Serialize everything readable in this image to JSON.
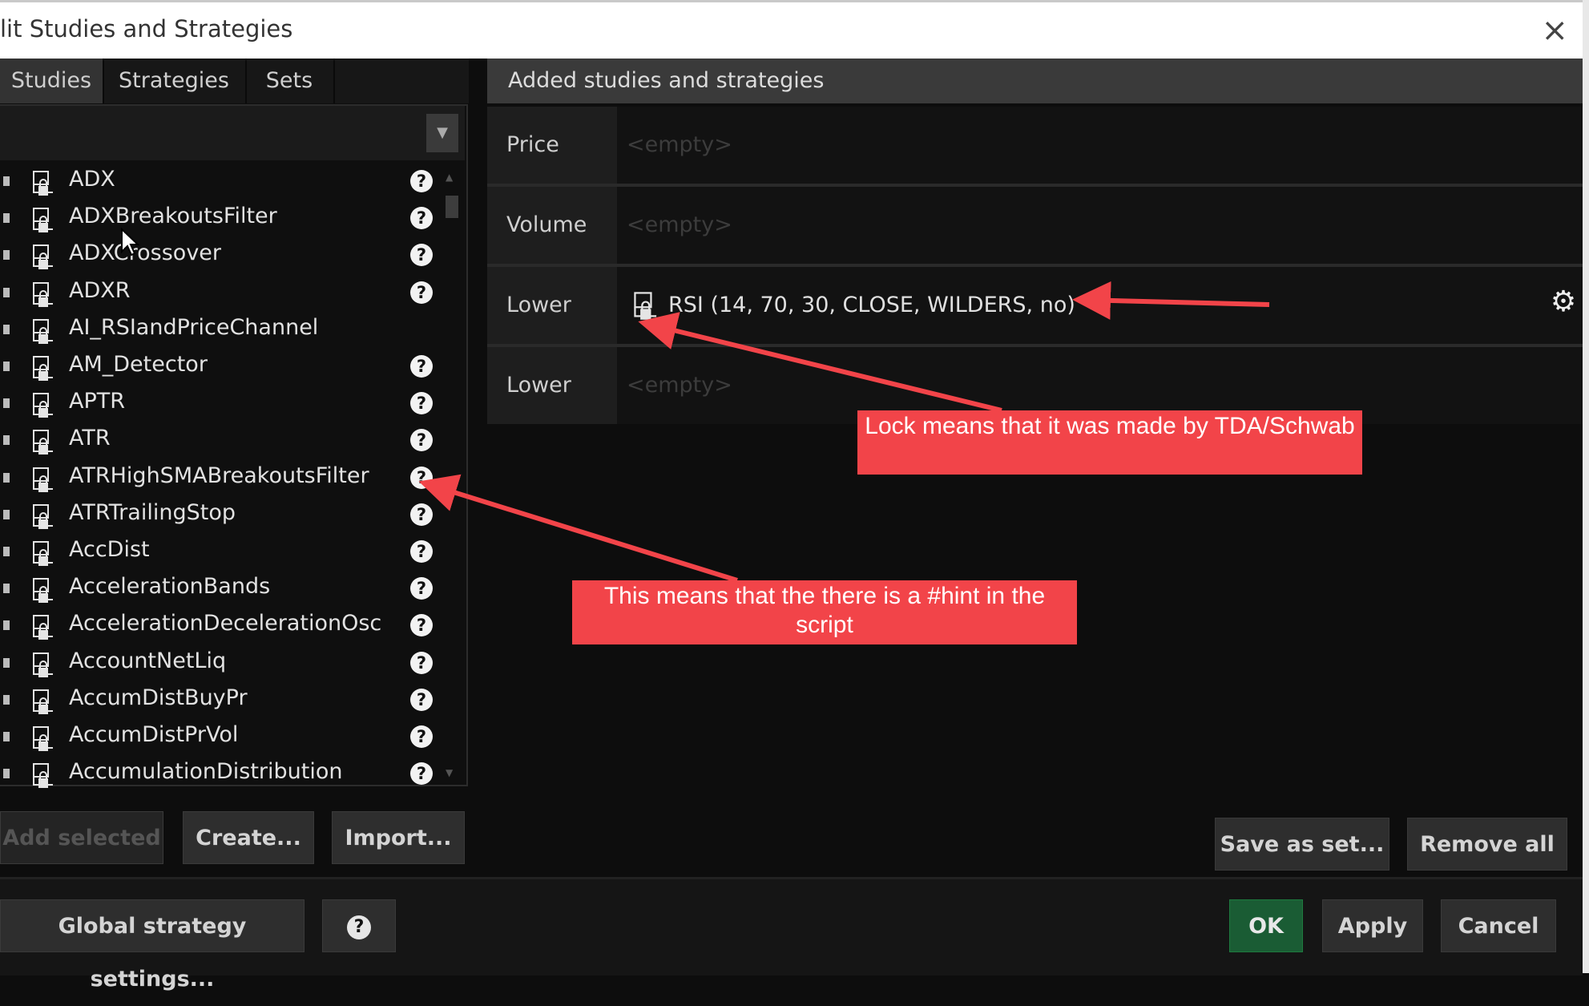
{
  "window": {
    "title": "lit Studies and Strategies",
    "close_symbol": "×"
  },
  "tabs": [
    {
      "label": "Studies",
      "active": true
    },
    {
      "label": "Strategies",
      "active": false
    },
    {
      "label": "Sets",
      "active": false
    }
  ],
  "search": {
    "value": ""
  },
  "studies": [
    {
      "name": "ADX",
      "hint": true
    },
    {
      "name": "ADXBreakoutsFilter",
      "hint": true
    },
    {
      "name": "ADXCrossover",
      "hint": true
    },
    {
      "name": "ADXR",
      "hint": true
    },
    {
      "name": "AI_RSIandPriceChannel",
      "hint": false
    },
    {
      "name": "AM_Detector",
      "hint": true
    },
    {
      "name": "APTR",
      "hint": true
    },
    {
      "name": "ATR",
      "hint": true
    },
    {
      "name": "ATRHighSMABreakoutsFilter",
      "hint": true
    },
    {
      "name": "ATRTrailingStop",
      "hint": true
    },
    {
      "name": "AccDist",
      "hint": true
    },
    {
      "name": "AccelerationBands",
      "hint": true
    },
    {
      "name": "AccelerationDecelerationOsc",
      "hint": true
    },
    {
      "name": "AccountNetLiq",
      "hint": true
    },
    {
      "name": "AccumDistBuyPr",
      "hint": true
    },
    {
      "name": "AccumDistPrVol",
      "hint": true
    },
    {
      "name": "AccumulationDistribution",
      "hint": true
    }
  ],
  "hint_symbol": "?",
  "added": {
    "header": "Added studies and strategies",
    "slots": [
      {
        "label": "Price",
        "content": "<empty>",
        "filled": false
      },
      {
        "label": "Volume",
        "content": "<empty>",
        "filled": false
      },
      {
        "label": "Lower",
        "content": "RSI (14, 70, 30, CLOSE, WILDERS, no)",
        "filled": true
      },
      {
        "label": "Lower",
        "content": "<empty>",
        "filled": false
      }
    ]
  },
  "buttons": {
    "add_selected": "Add selected",
    "create": "Create...",
    "import": "Import...",
    "save_as_set": "Save as set...",
    "remove_all": "Remove all",
    "global_settings": "Global strategy settings...",
    "help": "?",
    "ok": "OK",
    "apply": "Apply",
    "cancel": "Cancel"
  },
  "annotations": {
    "lock_note": "Lock means that it was made by TDA/Schwab",
    "hint_note": "This means that the there is a #hint in the script",
    "callout_color": "#f24449"
  },
  "icons": {
    "lock": "lock-icon",
    "hint": "question-icon",
    "gear": "gear-icon",
    "dropdown": "chevron-down-icon",
    "close": "close-icon"
  }
}
